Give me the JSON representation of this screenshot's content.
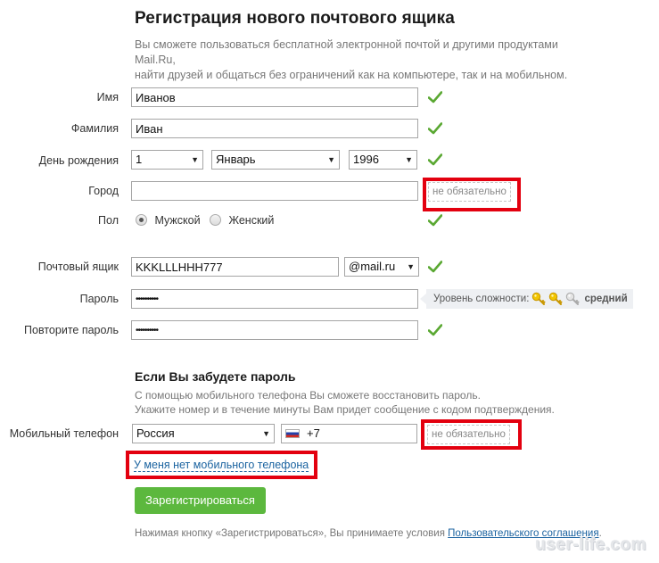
{
  "header": {
    "title": "Регистрация нового почтового ящика",
    "subtitle_line1": "Вы сможете пользоваться бесплатной электронной почтой и другими продуктами Mail.Ru,",
    "subtitle_line2": "найти друзей и общаться без ограничений как на компьютере, так и на мобильном."
  },
  "form": {
    "first_name": {
      "label": "Имя",
      "value": "Иванов",
      "valid": true
    },
    "last_name": {
      "label": "Фамилия",
      "value": "Иван",
      "valid": true
    },
    "birthday": {
      "label": "День рождения",
      "day": "1",
      "month": "Январь",
      "year": "1996",
      "valid": true
    },
    "city": {
      "label": "Город",
      "value": "",
      "hint": "не обязательно"
    },
    "gender": {
      "label": "Пол",
      "options": [
        {
          "label": "Мужской",
          "selected": true
        },
        {
          "label": "Женский",
          "selected": false
        }
      ],
      "valid": true
    },
    "mailbox": {
      "label": "Почтовый ящик",
      "value": "KKKLLLHHH777",
      "domain": "@mail.ru",
      "valid": true
    },
    "password": {
      "label": "Пароль",
      "value": "••••••••••",
      "strength_label": "Уровень сложности:",
      "strength_level": "средний",
      "strength_keys_filled": 2,
      "strength_keys_total": 3
    },
    "password_repeat": {
      "label": "Повторите пароль",
      "value": "••••••••••",
      "valid": true
    }
  },
  "recovery": {
    "title": "Если Вы забудете пароль",
    "desc_line1": "С помощью мобильного телефона Вы сможете восстановить пароль.",
    "desc_line2": "Укажите номер и в течение минуты Вам придет сообщение с кодом подтверждения.",
    "phone": {
      "label": "Мобильный телефон",
      "country": "Россия",
      "code": "+7",
      "hint": "не обязательно"
    },
    "no_phone_link": "У меня нет мобильного телефона"
  },
  "submit": {
    "button_label": "Зарегистрироваться",
    "terms_prefix": "Нажимая кнопку «Зарегистрироваться», Вы принимаете условия ",
    "terms_link": "Пользовательского соглашения",
    "terms_suffix": "."
  },
  "watermark": "user-life.com",
  "colors": {
    "accent_green": "#5cb83e",
    "check_green": "#5aa832",
    "highlight_red": "#e3000f",
    "link_blue": "#1b63a0"
  }
}
